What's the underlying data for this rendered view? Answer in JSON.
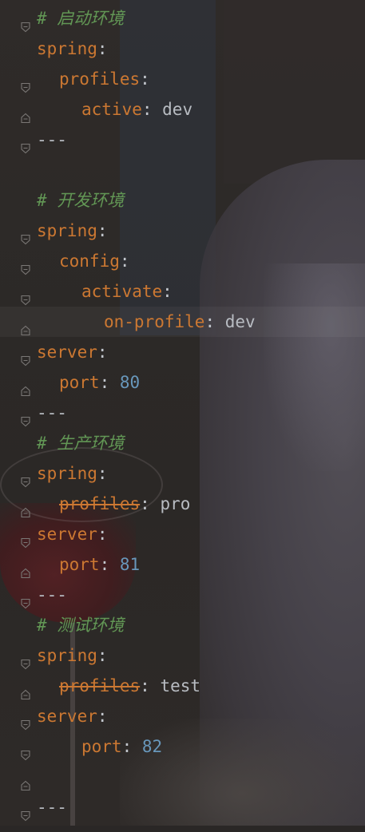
{
  "editor": {
    "language": "yaml",
    "lines": [
      {
        "indent": 0,
        "fold": "open",
        "comment": "# 启动环境"
      },
      {
        "indent": 0,
        "fold": "none",
        "key": "spring",
        "colon": ":"
      },
      {
        "indent": 1,
        "fold": "open",
        "key": "profiles",
        "colon": ":"
      },
      {
        "indent": 2,
        "fold": "close",
        "key": "active",
        "colon": ": ",
        "value": "dev"
      },
      {
        "indent": 0,
        "fold": "open",
        "separator": "---"
      },
      {
        "indent": 0,
        "fold": "none"
      },
      {
        "indent": 0,
        "fold": "none",
        "comment": "# 开发环境"
      },
      {
        "indent": 0,
        "fold": "open",
        "key": "spring",
        "colon": ":"
      },
      {
        "indent": 1,
        "fold": "open",
        "key": "config",
        "colon": ":"
      },
      {
        "indent": 2,
        "fold": "open",
        "key": "activate",
        "colon": ":"
      },
      {
        "indent": 3,
        "fold": "close",
        "key": "on-profile",
        "colon": ": ",
        "value": "dev",
        "highlight": true
      },
      {
        "indent": 0,
        "fold": "open",
        "key": "server",
        "colon": ":"
      },
      {
        "indent": 1,
        "fold": "close",
        "key": "port",
        "colon": ": ",
        "number": "80"
      },
      {
        "indent": 0,
        "fold": "open",
        "separator": "---"
      },
      {
        "indent": 0,
        "fold": "none",
        "comment": "# 生产环境"
      },
      {
        "indent": 0,
        "fold": "open",
        "key": "spring",
        "colon": ":"
      },
      {
        "indent": 1,
        "fold": "close",
        "key": "profiles",
        "deprecated": true,
        "colon": ": ",
        "value": "pro"
      },
      {
        "indent": 0,
        "fold": "open",
        "key": "server",
        "colon": ":"
      },
      {
        "indent": 1,
        "fold": "close",
        "key": "port",
        "colon": ": ",
        "number": "81"
      },
      {
        "indent": 0,
        "fold": "open",
        "separator": "---"
      },
      {
        "indent": 0,
        "fold": "none",
        "comment": "# 测试环境"
      },
      {
        "indent": 0,
        "fold": "open",
        "key": "spring",
        "colon": ":"
      },
      {
        "indent": 1,
        "fold": "close",
        "key": "profiles",
        "deprecated": true,
        "colon": ": ",
        "value": "test"
      },
      {
        "indent": 0,
        "fold": "open",
        "key": "server",
        "colon": ":"
      },
      {
        "indent": 2,
        "fold": "open",
        "key": "port",
        "colon": ": ",
        "number": "82"
      },
      {
        "indent": 0,
        "fold": "close"
      },
      {
        "indent": 0,
        "fold": "open",
        "separator": "---"
      }
    ]
  },
  "colors": {
    "key": "#cc7832",
    "comment": "#629755",
    "number": "#6897bb",
    "value": "#b8bcc2",
    "background": "#2a2726"
  },
  "icons": {
    "fold_open": "fold-open-icon",
    "fold_close": "fold-close-icon"
  }
}
